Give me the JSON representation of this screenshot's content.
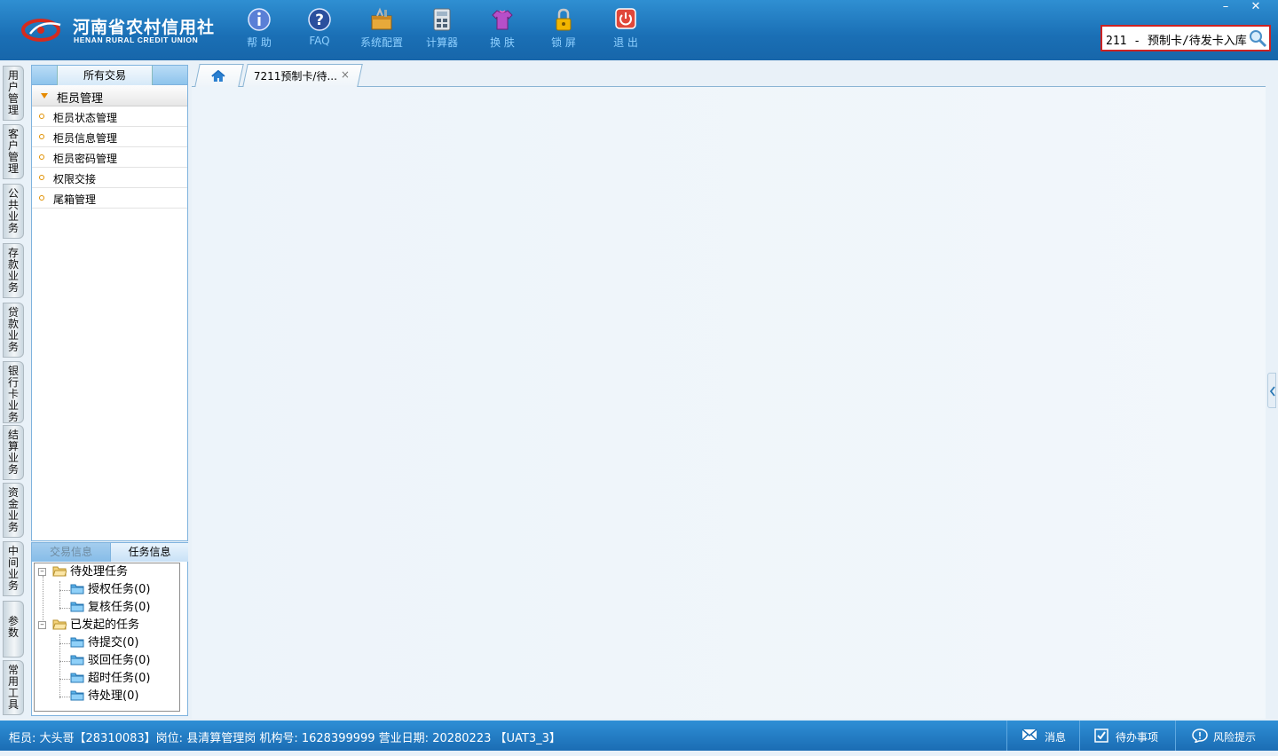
{
  "app": {
    "logo_cn": "河南省农村信用社",
    "logo_en": "HENAN RURAL CREDIT UNION"
  },
  "toolbar": {
    "help": "帮 助",
    "faq": "FAQ",
    "config": "系统配置",
    "calculator": "计算器",
    "skin": "换 肤",
    "lock": "锁 屏",
    "exit": "退 出"
  },
  "window": {
    "minimize": "–",
    "close": "✕"
  },
  "search": {
    "value": "211 - 预制卡/待发卡入库"
  },
  "side_tabs": [
    {
      "label": "用户管理"
    },
    {
      "label": "客户管理"
    },
    {
      "label": "公共业务"
    },
    {
      "label": "存款业务"
    },
    {
      "label": "贷款业务"
    },
    {
      "label": "银行卡业务"
    },
    {
      "label": "结算业务"
    },
    {
      "label": "资金业务"
    },
    {
      "label": "中间业务"
    },
    {
      "label": "参数"
    },
    {
      "label": "常用工具"
    }
  ],
  "left_panel": {
    "header": "所有交易",
    "group": "柜员管理",
    "items": [
      "柜员状态管理",
      "柜员信息管理",
      "柜员密码管理",
      "权限交接",
      "尾箱管理"
    ]
  },
  "task_panel": {
    "tab_trans": "交易信息",
    "tab_task": "任务信息",
    "tree": {
      "pending": "待处理任务",
      "auth": "授权任务(0)",
      "review": "复核任务(0)",
      "initiated": "已发起的任务",
      "to_submit": "待提交(0)",
      "rejected": "驳回任务(0)",
      "timeout": "超时任务(0)",
      "processing": "待处理(0)"
    }
  },
  "tabs": {
    "open_tab": "7211预制卡/待...",
    "close": "×"
  },
  "status": {
    "info": "柜员: 大头哥【28310083】岗位: 县清算管理岗  机构号: 1628399999  营业日期: 20280223 【UAT3_3】",
    "message": "消息",
    "todo": "待办事项",
    "risk": "风险提示"
  },
  "colors": {
    "header_blue": "#1a6fb5",
    "tool_label": "#8fd0ff",
    "search_border": "#cc2222"
  }
}
